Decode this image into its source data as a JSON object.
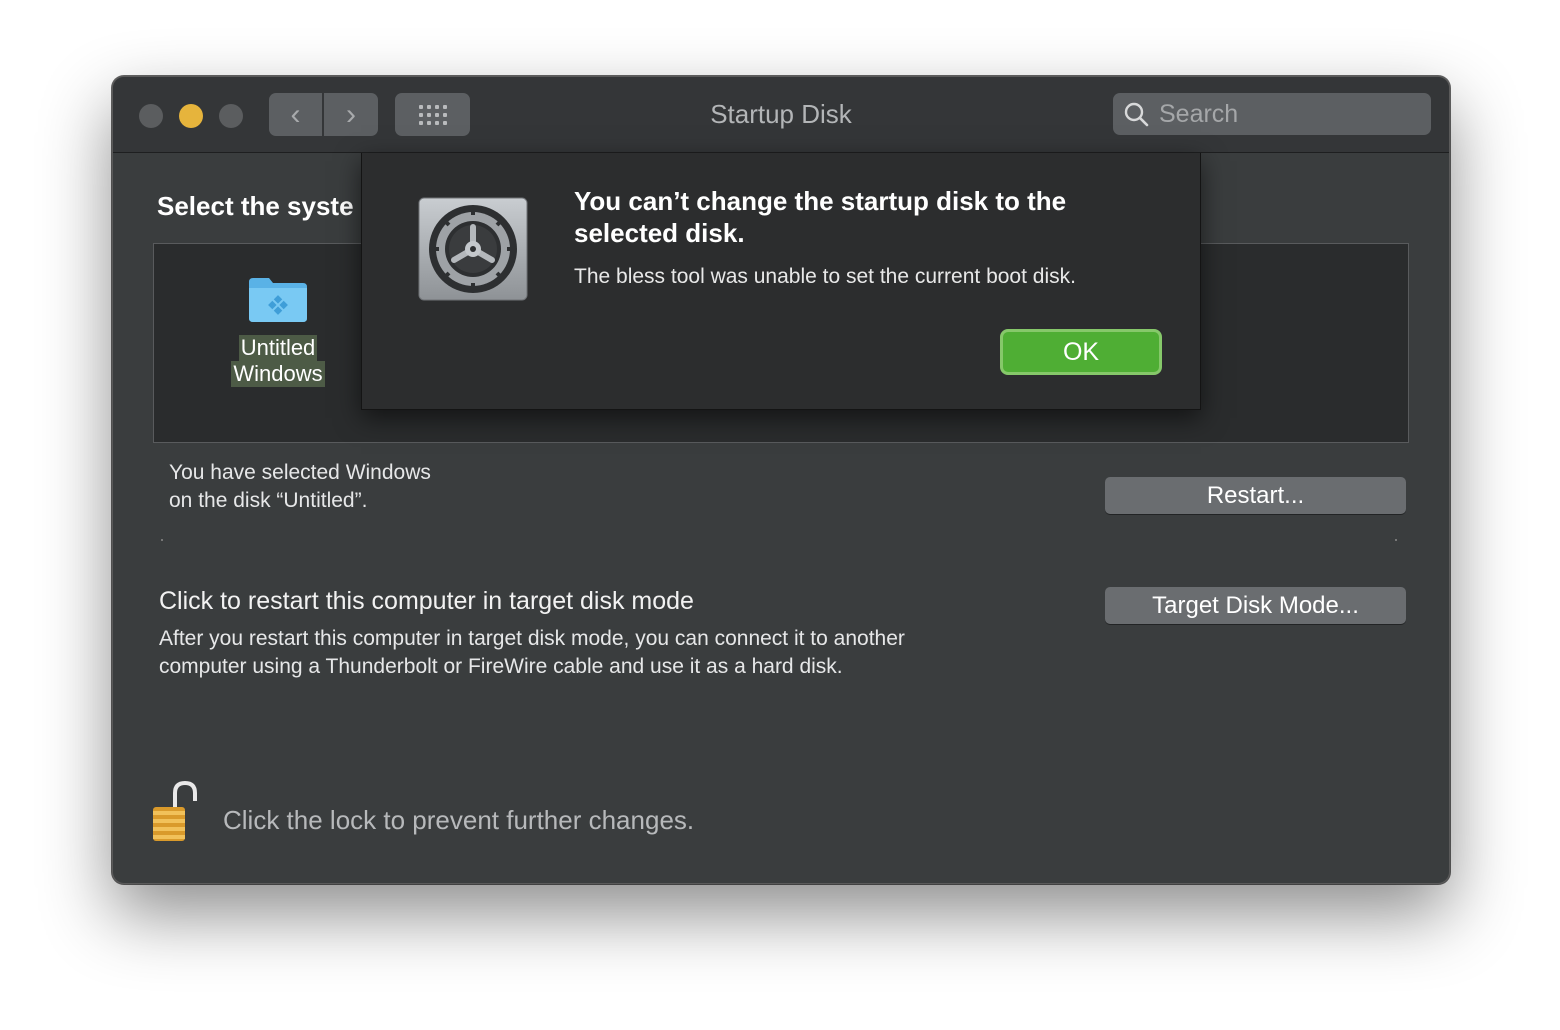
{
  "window": {
    "title": "Startup Disk",
    "search_placeholder": "Search"
  },
  "toolbar": {
    "back_glyph": "‹",
    "forward_glyph": "›"
  },
  "main": {
    "heading": "Select the syste",
    "disks": [
      {
        "line1": "Untitled",
        "line2": "Windows",
        "icon": "windows-folder-icon"
      }
    ],
    "selected_line1": "You have selected Windows",
    "selected_line2": "on the disk “Untitled”.",
    "restart_label": "Restart...",
    "target_title": "Click to restart this computer in target disk mode",
    "target_desc": "After you restart this computer in target disk mode, you can connect it to another computer using a Thunderbolt or FireWire cable and use it as a hard disk.",
    "target_label": "Target Disk Mode...",
    "lock_text": "Click the lock to prevent further changes."
  },
  "alert": {
    "title": "You can’t change the startup disk to the selected disk.",
    "message": "The bless tool was unable to set the current boot disk.",
    "ok_label": "OK",
    "icon": "system-preferences-gear-icon"
  },
  "colors": {
    "window_bg": "#3a3d3e",
    "minimize": "#e6b43c",
    "ok_button": "#4fae34",
    "folder": "#6fc3f0"
  }
}
